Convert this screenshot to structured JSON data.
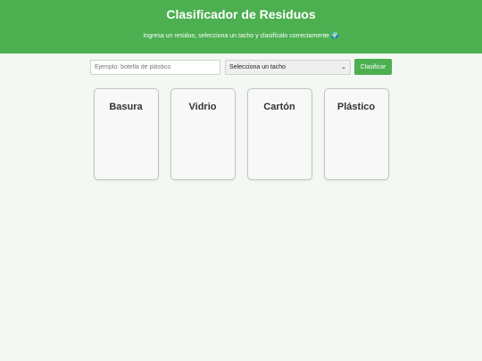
{
  "header": {
    "title": "Clasificador de Residuos",
    "subtitle": "Ingresa un residuo, selecciona un tacho y clasifícalo correctamente 🌍"
  },
  "controls": {
    "input_placeholder": "Ejemplo: botella de plástico",
    "select_value": "Selecciona un tacho",
    "classify_label": "Clasificar"
  },
  "bins": [
    {
      "label": "Basura"
    },
    {
      "label": "Vidrio"
    },
    {
      "label": "Cartón"
    },
    {
      "label": "Plástico"
    }
  ],
  "colors": {
    "brand": "#4caf50",
    "background": "#f3f8f2"
  }
}
